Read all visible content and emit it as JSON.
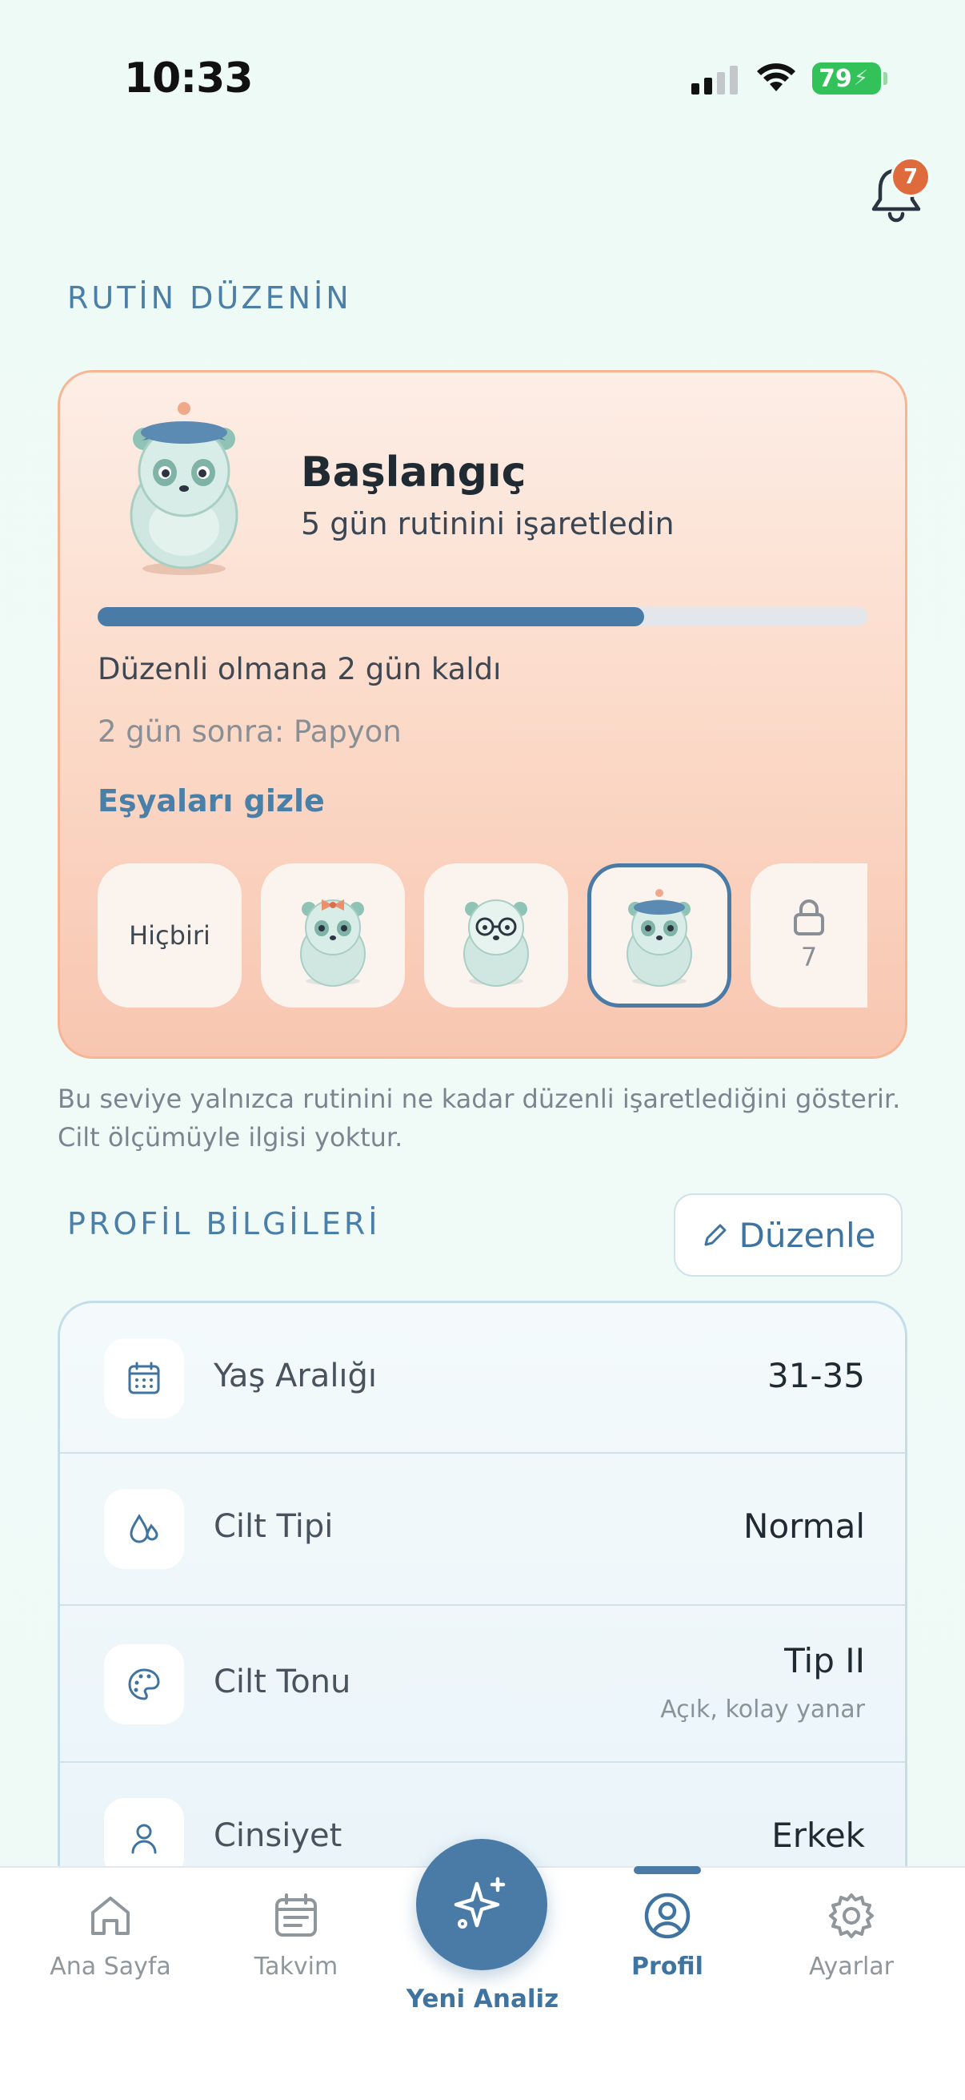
{
  "status_bar": {
    "time": "10:33",
    "battery": "79"
  },
  "notifications": {
    "count": "7"
  },
  "routine_section": {
    "title": "RUTİN DÜZENİN"
  },
  "routine_card": {
    "level_title": "Başlangıç",
    "level_subtitle": "5 gün rutinini işaretledin",
    "progress": 0.71,
    "days_left": "Düzenli olmana 2 gün kaldı",
    "next_item": "2 gün sonra: Papyon",
    "hide_items_label": "Eşyaları gizle",
    "items": [
      {
        "label": "Hiçbiri",
        "type": "none"
      },
      {
        "type": "bow-mascot"
      },
      {
        "type": "glasses-mascot"
      },
      {
        "type": "beret-mascot",
        "selected": true
      },
      {
        "type": "locked",
        "count": "7"
      }
    ]
  },
  "disclaimer": "Bu seviye yalnızca rutinini ne kadar düzenli işaretlediğini gösterir. Cilt ölçümüyle ilgisi yoktur.",
  "profile_section": {
    "title": "PROFİL BİLGİLERİ",
    "edit_label": "Düzenle",
    "rows": [
      {
        "icon": "calendar-icon",
        "label": "Yaş Aralığı",
        "value": "31-35"
      },
      {
        "icon": "drops-icon",
        "label": "Cilt Tipi",
        "value": "Normal"
      },
      {
        "icon": "palette-icon",
        "label": "Cilt Tonu",
        "value": "Tip II",
        "sub": "Açık, kolay yanar"
      },
      {
        "icon": "person-icon",
        "label": "Cinsiyet",
        "value": "Erkek"
      }
    ]
  },
  "tabbar": {
    "home": "Ana Sayfa",
    "calendar": "Takvim",
    "new_analysis": "Yeni Analiz",
    "profile": "Profil",
    "settings": "Ayarlar",
    "active": "profile"
  },
  "colors": {
    "accent": "#4a7ba6",
    "badge": "#df6a3c",
    "battery": "#33c15a"
  }
}
